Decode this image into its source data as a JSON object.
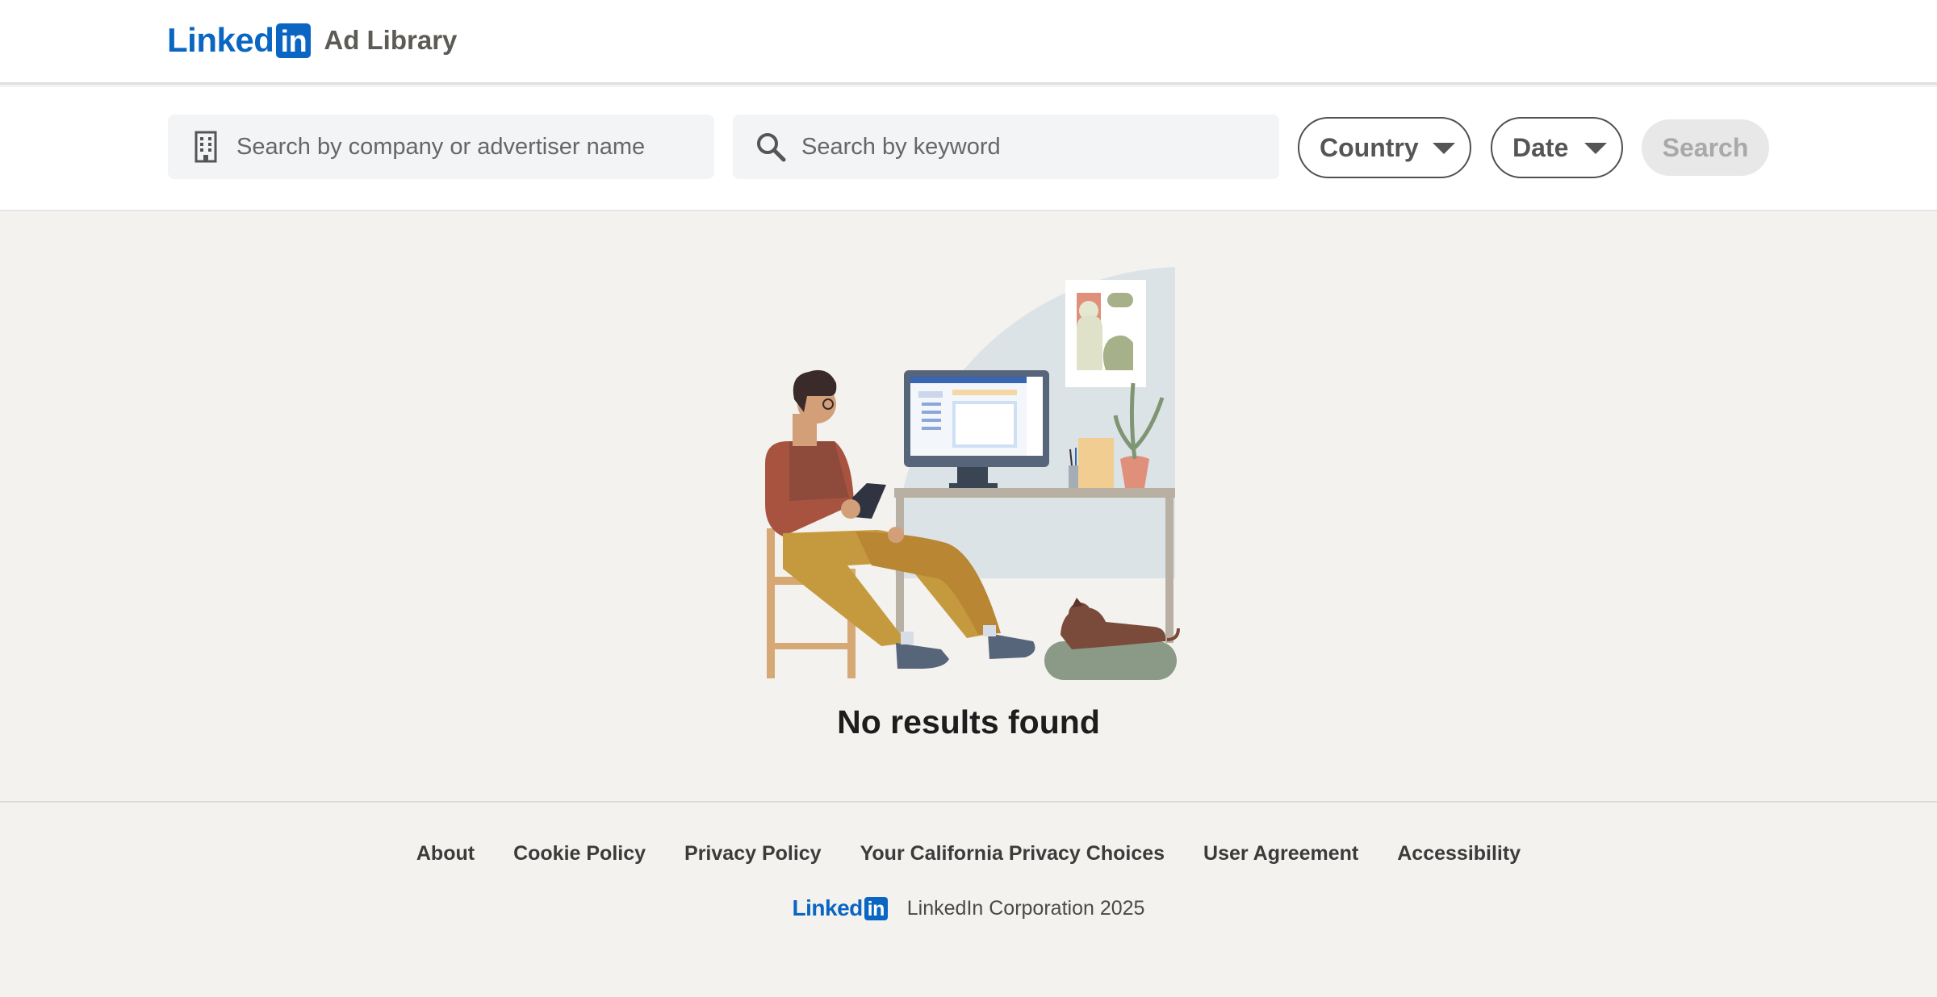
{
  "header": {
    "logo_text": "Linked",
    "logo_in": "in",
    "title": "Ad Library"
  },
  "search": {
    "company_placeholder": "Search by company or advertiser name",
    "keyword_placeholder": "Search by keyword",
    "country_label": "Country",
    "date_label": "Date",
    "search_button": "Search"
  },
  "empty_state": {
    "message": "No results found"
  },
  "footer": {
    "links": [
      "About",
      "Cookie Policy",
      "Privacy Policy",
      "Your California Privacy Choices",
      "User Agreement",
      "Accessibility"
    ],
    "logo_text": "Linked",
    "logo_in": "in",
    "copyright": "LinkedIn Corporation 2025"
  },
  "colors": {
    "brand": "#0a66c2",
    "page_background": "#f3f2ef",
    "search_disabled": "#e8e8e8"
  }
}
